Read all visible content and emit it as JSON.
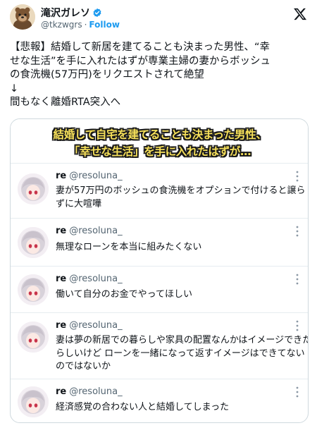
{
  "author": {
    "display_name": "滝沢ガレソ",
    "handle": "@tkzwgrs",
    "separator": "·",
    "follow_label": "Follow",
    "verified_color": "#1d9bf0"
  },
  "tweet": {
    "lines": [
      "【悲報】結婚して新居を建てることも決まった男性、“幸",
      "せな生活”を手に入れたはずが専業主婦の妻からボッシュ",
      "の食洗機(57万円)をリクエストされて絶望",
      "↓",
      "間もなく離婚RTA突入へ"
    ]
  },
  "card": {
    "banner_line1": "結婚して自宅を建てることも決まった男性、",
    "banner_line2": "「幸せな生活」を手に入れたはずが…",
    "banner_text_color": "#f7e15a",
    "replies": [
      {
        "name": "re",
        "handle": "@resoluna_",
        "lines": [
          "妻が57万円のボッシュの食洗機をオプションで付けると譲ら",
          "ずに大喧嘩"
        ]
      },
      {
        "name": "re",
        "handle": "@resoluna_",
        "lines": [
          "無理なローンを本当に組みたくない"
        ]
      },
      {
        "name": "re",
        "handle": "@resoluna_",
        "lines": [
          "働いて自分のお金でやってほしい"
        ]
      },
      {
        "name": "re",
        "handle": "@resoluna_",
        "lines": [
          "妻は夢の新居での暮らしや家具の配置なんかはイメージできた",
          "らしいけど ローンを一緒になって返すイメージはできてない",
          "のではないか"
        ]
      },
      {
        "name": "re",
        "handle": "@resoluna_",
        "lines": [
          "経済感覚の合わない人と結婚してしまった"
        ]
      }
    ]
  },
  "icons": {
    "verified": "verified-badge-icon",
    "logo": "x-logo-icon",
    "more": "more-options-icon"
  }
}
